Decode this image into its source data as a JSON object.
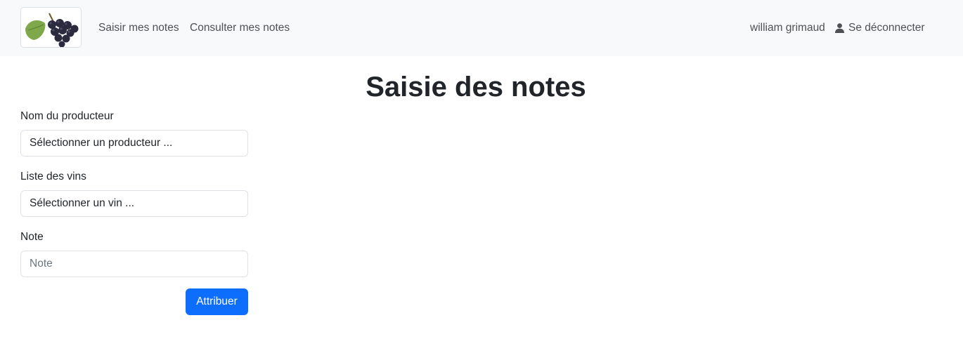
{
  "navbar": {
    "logo_icon": "grapes-logo",
    "links": [
      {
        "label": "Saisir mes notes"
      },
      {
        "label": "Consulter mes notes"
      }
    ],
    "user_name": "william grimaud",
    "user_icon": "person-icon",
    "logout_label": "Se déconnecter"
  },
  "main": {
    "title": "Saisie des notes",
    "producer": {
      "label": "Nom du producteur",
      "value": "Sélectionner un producteur ..."
    },
    "wine": {
      "label": "Liste des vins",
      "value": "Sélectionner un vin ..."
    },
    "note": {
      "label": "Note",
      "placeholder": "Note",
      "value": ""
    },
    "submit_label": "Attribuer"
  },
  "colors": {
    "navbar_bg": "#f8f9fa",
    "primary": "#0d6efd",
    "border": "#dee2e6",
    "text": "#212529",
    "muted": "#4d5154"
  }
}
